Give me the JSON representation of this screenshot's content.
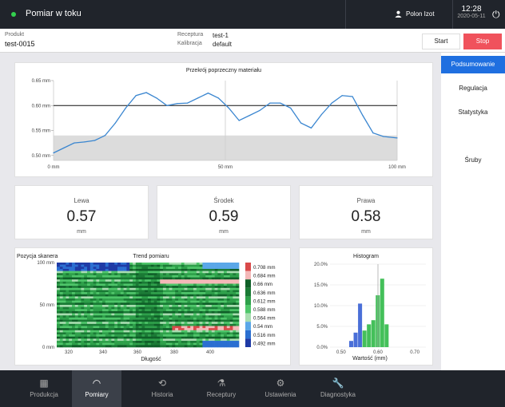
{
  "topbar": {
    "title": "Pomiar w toku",
    "user": "Polon Izot",
    "time": "12:28",
    "date": "2020-05-11"
  },
  "info": {
    "product_label": "Produkt",
    "product_value": "test-0015",
    "recipe_label": "Receptura",
    "recipe_value": "test-1",
    "calibration_label": "Kalibracja",
    "calibration_value": "default"
  },
  "buttons": {
    "start": "Start",
    "stop": "Stop"
  },
  "sidemenu": [
    "Podsumowanie",
    "Regulacja",
    "Statystyka",
    "Śruby"
  ],
  "cards": [
    {
      "label": "Lewa",
      "value": "0.57",
      "unit": "mm"
    },
    {
      "label": "Środek",
      "value": "0.59",
      "unit": "mm"
    },
    {
      "label": "Prawa",
      "value": "0.58",
      "unit": "mm"
    }
  ],
  "bottomnav": [
    "Produkcja",
    "Pomiary",
    "Historia",
    "Receptury",
    "Ustawienia",
    "Diagnostyka"
  ],
  "colors": {
    "accent": "#1f6fe0",
    "stop": "#f0525c",
    "status": "#33d04e"
  },
  "chart_data": [
    {
      "type": "line",
      "title": "Przekrój poprzeczny materiału",
      "xlim": [
        0,
        100
      ],
      "ylim": [
        0.49,
        0.65
      ],
      "x_ticks": [
        "0 mm",
        "50 mm",
        "100 mm"
      ],
      "y_ticks": [
        "0.65 mm",
        "0.60 mm",
        "0.55 mm",
        "0.50 mm"
      ],
      "reference_line": 0.6,
      "lower_band": [
        0.49,
        0.54
      ],
      "x": [
        0,
        3,
        6,
        9,
        12,
        15,
        18,
        21,
        24,
        27,
        30,
        33,
        36,
        39,
        42,
        45,
        48,
        51,
        54,
        57,
        60,
        63,
        66,
        69,
        72,
        75,
        78,
        81,
        84,
        87,
        90,
        93,
        96,
        100
      ],
      "values": [
        0.505,
        0.515,
        0.525,
        0.527,
        0.53,
        0.54,
        0.565,
        0.595,
        0.62,
        0.626,
        0.615,
        0.6,
        0.604,
        0.605,
        0.615,
        0.625,
        0.615,
        0.595,
        0.57,
        0.58,
        0.59,
        0.605,
        0.605,
        0.595,
        0.565,
        0.555,
        0.582,
        0.605,
        0.62,
        0.618,
        0.58,
        0.545,
        0.538,
        0.535
      ]
    },
    {
      "type": "heatmap",
      "title": "Trend pomiaru",
      "ylabel": "Pozycja skanera",
      "xlabel": "Długość",
      "x_ticks": [
        "320",
        "340",
        "360",
        "380",
        "400"
      ],
      "y_ticks": [
        "100 mm",
        "50 mm",
        "0 mm"
      ],
      "colorbar": [
        "0.708 mm",
        "0.684 mm",
        "0.66 mm",
        "0.636 mm",
        "0.612 mm",
        "0.588 mm",
        "0.564 mm",
        "0.54 mm",
        "0.516 mm",
        "0.492 mm"
      ]
    },
    {
      "type": "bar",
      "title": "Histogram",
      "xlabel": "Wartość (mm)",
      "x_ticks": [
        "0.50",
        "0.60",
        "0.70"
      ],
      "y_ticks": [
        "20.0%",
        "15.0%",
        "10.0%",
        "5.0%",
        "0.0%"
      ],
      "xlim": [
        0.47,
        0.73
      ],
      "ylim": [
        0,
        20
      ],
      "bin_width": 0.012,
      "series": [
        {
          "color": "#4a6fd8",
          "x": [
            0.528,
            0.54,
            0.552
          ],
          "values": [
            1.5,
            3.5,
            10.5
          ]
        },
        {
          "color": "#44c05a",
          "x": [
            0.564,
            0.576,
            0.588,
            0.6,
            0.612,
            0.624
          ],
          "values": [
            4.0,
            5.5,
            6.5,
            12.5,
            16.5,
            5.5
          ]
        }
      ],
      "vertical_line": 0.6
    }
  ]
}
